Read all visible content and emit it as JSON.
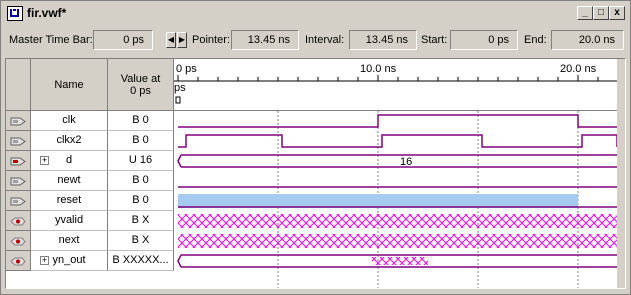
{
  "window": {
    "title": "fir.vwf*",
    "controls": {
      "minimize": "_",
      "maximize": "□",
      "close": "x"
    }
  },
  "toolbar": {
    "master_label": "Master Time Bar:",
    "master_value": "0 ps",
    "pointer_label": "Pointer:",
    "pointer_value": "13.45 ns",
    "interval_label": "Interval:",
    "interval_value": "13.45 ns",
    "start_label": "Start:",
    "start_value": "0 ps",
    "end_label": "End:",
    "end_value": "20.0 ns"
  },
  "columns": {
    "name_header": "Name",
    "value_header_line1": "Value at",
    "value_header_line2": "0 ps"
  },
  "ruler": {
    "ticks": [
      "0 ps",
      "10.0 ns",
      "20.0 ns"
    ],
    "cursor_label": "ps"
  },
  "signals": [
    {
      "name": "clk",
      "value": "B 0",
      "type": "input",
      "expandable": false
    },
    {
      "name": "clkx2",
      "value": "B 0",
      "type": "input",
      "expandable": false
    },
    {
      "name": "d",
      "value": "U 16",
      "type": "input",
      "expandable": true,
      "bus_label": "16"
    },
    {
      "name": "newt",
      "value": "B 0",
      "type": "input",
      "expandable": false
    },
    {
      "name": "reset",
      "value": "B 0",
      "type": "input",
      "expandable": false
    },
    {
      "name": "yvalid",
      "value": "B X",
      "type": "output",
      "expandable": false
    },
    {
      "name": "next",
      "value": "B X",
      "type": "output",
      "expandable": false
    },
    {
      "name": "yn_out",
      "value": "B XXXXX...",
      "type": "output",
      "expandable": true
    }
  ],
  "colors": {
    "wave": "#800080",
    "reset_fill": "#a6caf0",
    "hatch": "#ff00ff",
    "grid": "#808080"
  }
}
